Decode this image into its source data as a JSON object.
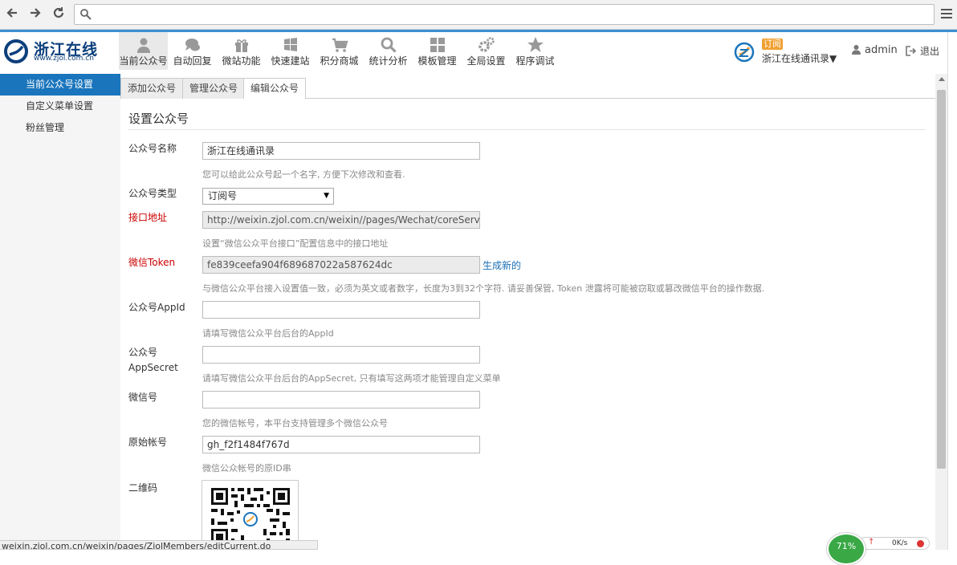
{
  "browser": {
    "address_value": "",
    "back_icon": "back-arrow-icon",
    "forward_icon": "forward-arrow-icon",
    "reload_icon": "reload-icon"
  },
  "brand": {
    "name": "浙江在线",
    "url": "www.zjol.com.cn"
  },
  "topnav": [
    {
      "label": "当前公众号",
      "icon": "user-icon",
      "active": true
    },
    {
      "label": "自动回复",
      "icon": "chat-icon"
    },
    {
      "label": "微站功能",
      "icon": "gift-icon"
    },
    {
      "label": "快速建站",
      "icon": "windows-icon"
    },
    {
      "label": "积分商城",
      "icon": "cart-icon"
    },
    {
      "label": "统计分析",
      "icon": "search-icon"
    },
    {
      "label": "模板管理",
      "icon": "grid-icon"
    },
    {
      "label": "全局设置",
      "icon": "gears-icon"
    },
    {
      "label": "程序调试",
      "icon": "star-icon"
    }
  ],
  "account": {
    "badge": "订阅",
    "name": "浙江在线通讯录▼",
    "user": "admin",
    "logout": "退出"
  },
  "sidebar": {
    "items": [
      {
        "label": "当前公众号设置",
        "active": true
      },
      {
        "label": "自定义菜单设置"
      },
      {
        "label": "粉丝管理"
      }
    ]
  },
  "tabs": [
    {
      "label": "添加公众号"
    },
    {
      "label": "管理公众号"
    },
    {
      "label": "编辑公众号",
      "active": true
    }
  ],
  "form": {
    "title": "设置公众号",
    "name_label": "公众号名称",
    "name_value": "浙江在线通讯录",
    "name_help": "您可以给此公众号起一个名字, 方便下次修改和查看.",
    "type_label": "公众号类型",
    "type_value": "订阅号",
    "api_label": "接口地址",
    "api_value": "http://weixin.zjol.com.cn/weixin//pages/Wechat/coreServlet.do",
    "api_help": "设置“微信公众平台接口”配置信息中的接口地址",
    "token_label": "微信Token",
    "token_value": "fe839ceefa904f689687022a587624dc",
    "token_generate": "生成新的",
    "token_help": "与微信公众平台接入设置值一致，必须为英文或者数字，长度为3到32个字符. 请妥善保管, Token 泄露将可能被窃取或篡改微信平台的操作数据.",
    "appid_label": "公众号AppId",
    "appid_value": "",
    "appid_help": "请填写微信公众平台后台的AppId",
    "secret_label_1": "公众号",
    "secret_label_2": "AppSecret",
    "secret_value": "",
    "secret_help": "请填写微信公众平台后台的AppSecret, 只有填写这两项才能管理自定义菜单",
    "wechat_label": "微信号",
    "wechat_value": "",
    "wechat_help": "您的微信帐号，本平台支持管理多个微信公众号",
    "origin_label": "原始帐号",
    "origin_value": "gh_f2f1484f767d",
    "origin_help": "微信公众帐号的原ID串",
    "qr_label": "二维码"
  },
  "status": {
    "url": "weixin.zjol.com.cn/weixin/pages/ZjolMembers/editCurrent.do",
    "speed_percent": "71%",
    "speed_rate": "0K/s"
  },
  "colors": {
    "accent": "#1a75bc",
    "brand_navy": "#0c3f7c",
    "required_label": "#cc0000"
  }
}
